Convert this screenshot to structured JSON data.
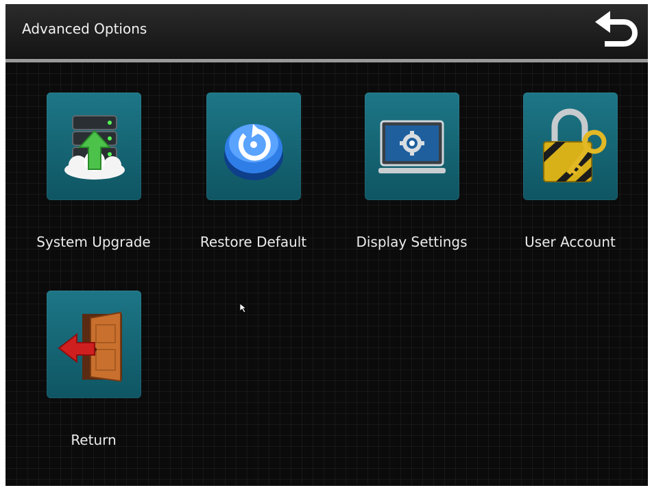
{
  "header": {
    "title": "Advanced Options",
    "back_icon": "return-arrow-icon"
  },
  "menu": {
    "items": [
      {
        "label": "System Upgrade",
        "icon": "server-upgrade-icon"
      },
      {
        "label": "Restore Default",
        "icon": "restore-button-icon"
      },
      {
        "label": "Display Settings",
        "icon": "monitor-settings-icon"
      },
      {
        "label": "User Account",
        "icon": "padlock-key-icon"
      },
      {
        "label": "Return",
        "icon": "exit-door-icon"
      }
    ]
  },
  "colors": {
    "background": "#0b0b0b",
    "titlebar": "#1e1e1e",
    "tile": "#16687a",
    "text": "#ececec"
  }
}
